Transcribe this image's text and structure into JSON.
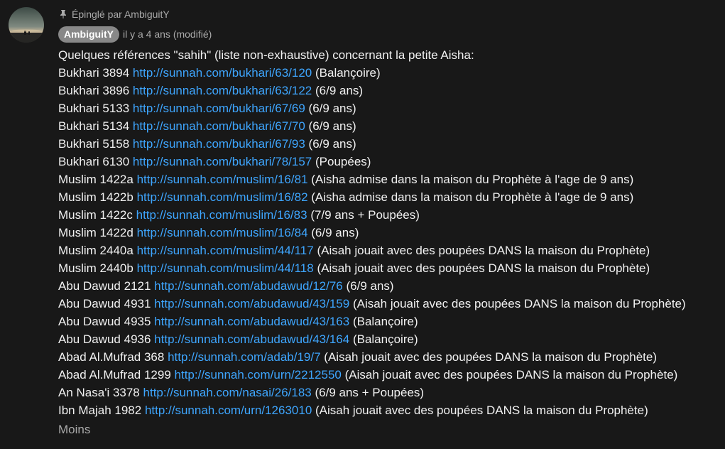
{
  "comment": {
    "pinned_label": "Épinglé par AmbiguitY",
    "author": "AmbiguitY",
    "timestamp": "il y a 4 ans (modifié)",
    "intro": "Quelques références \"sahih\" (liste non-exhaustive) concernant la petite Aisha:",
    "references": [
      {
        "source": "Bukhari 3894",
        "url": "http://sunnah.com/bukhari/63/120",
        "note": "(Balançoire)"
      },
      {
        "source": "Bukhari 3896",
        "url": "http://sunnah.com/bukhari/63/122",
        "note": "(6/9 ans)"
      },
      {
        "source": "Bukhari 5133",
        "url": "http://sunnah.com/bukhari/67/69",
        "note": "(6/9 ans)"
      },
      {
        "source": "Bukhari 5134",
        "url": "http://sunnah.com/bukhari/67/70",
        "note": "(6/9 ans)"
      },
      {
        "source": "Bukhari 5158",
        "url": "http://sunnah.com/bukhari/67/93",
        "note": "(6/9 ans)"
      },
      {
        "source": "Bukhari 6130",
        "url": "http://sunnah.com/bukhari/78/157",
        "note": "(Poupées)"
      },
      {
        "source": "Muslim 1422a",
        "url": "http://sunnah.com/muslim/16/81",
        "note": "(Aisha admise dans la maison du Prophète à l'age de 9 ans)"
      },
      {
        "source": "Muslim 1422b",
        "url": "http://sunnah.com/muslim/16/82",
        "note": "(Aisha admise dans la maison du Prophète à l'age de 9 ans)"
      },
      {
        "source": "Muslim 1422c",
        "url": "http://sunnah.com/muslim/16/83",
        "note": "(7/9 ans + Poupées)"
      },
      {
        "source": "Muslim 1422d",
        "url": "http://sunnah.com/muslim/16/84",
        "note": "(6/9 ans)"
      },
      {
        "source": "Muslim 2440a",
        "url": "http://sunnah.com/muslim/44/117",
        "note": "(Aisah jouait avec des poupées DANS la maison du Prophète)"
      },
      {
        "source": "Muslim 2440b",
        "url": "http://sunnah.com/muslim/44/118",
        "note": "(Aisah jouait avec des poupées DANS la maison du Prophète)"
      },
      {
        "source": "Abu Dawud 2121",
        "url": "http://sunnah.com/abudawud/12/76",
        "note": "(6/9 ans)"
      },
      {
        "source": "Abu Dawud 4931",
        "url": "http://sunnah.com/abudawud/43/159",
        "note": "(Aisah jouait avec des poupées DANS la maison du Prophète)"
      },
      {
        "source": "Abu Dawud 4935",
        "url": "http://sunnah.com/abudawud/43/163",
        "note": "(Balançoire)"
      },
      {
        "source": "Abu Dawud 4936",
        "url": "http://sunnah.com/abudawud/43/164",
        "note": "(Balançoire)"
      },
      {
        "source": "Abad Al.Mufrad 368",
        "url": "http://sunnah.com/adab/19/7",
        "note": "(Aisah jouait avec des poupées DANS la maison du Prophète)"
      },
      {
        "source": "Abad Al.Mufrad 1299",
        "url": "http://sunnah.com/urn/2212550",
        "note": "(Aisah jouait avec des poupées DANS la maison du Prophète)"
      },
      {
        "source": "An Nasa'i 3378",
        "url": "http://sunnah.com/nasai/26/183",
        "note": "(6/9 ans + Poupées)"
      },
      {
        "source": "Ibn Majah 1982",
        "url": "http://sunnah.com/urn/1263010",
        "note": "(Aisah jouait avec des poupées DANS la maison du Prophète)"
      }
    ],
    "less_label": "Moins"
  },
  "icons": {
    "pin": "pin-icon",
    "avatar": "avatar-image"
  },
  "colors": {
    "background": "#181818",
    "text": "#f1f1f1",
    "muted": "#aaaaaa",
    "link": "#3ea6ff",
    "badge": "#888888"
  }
}
